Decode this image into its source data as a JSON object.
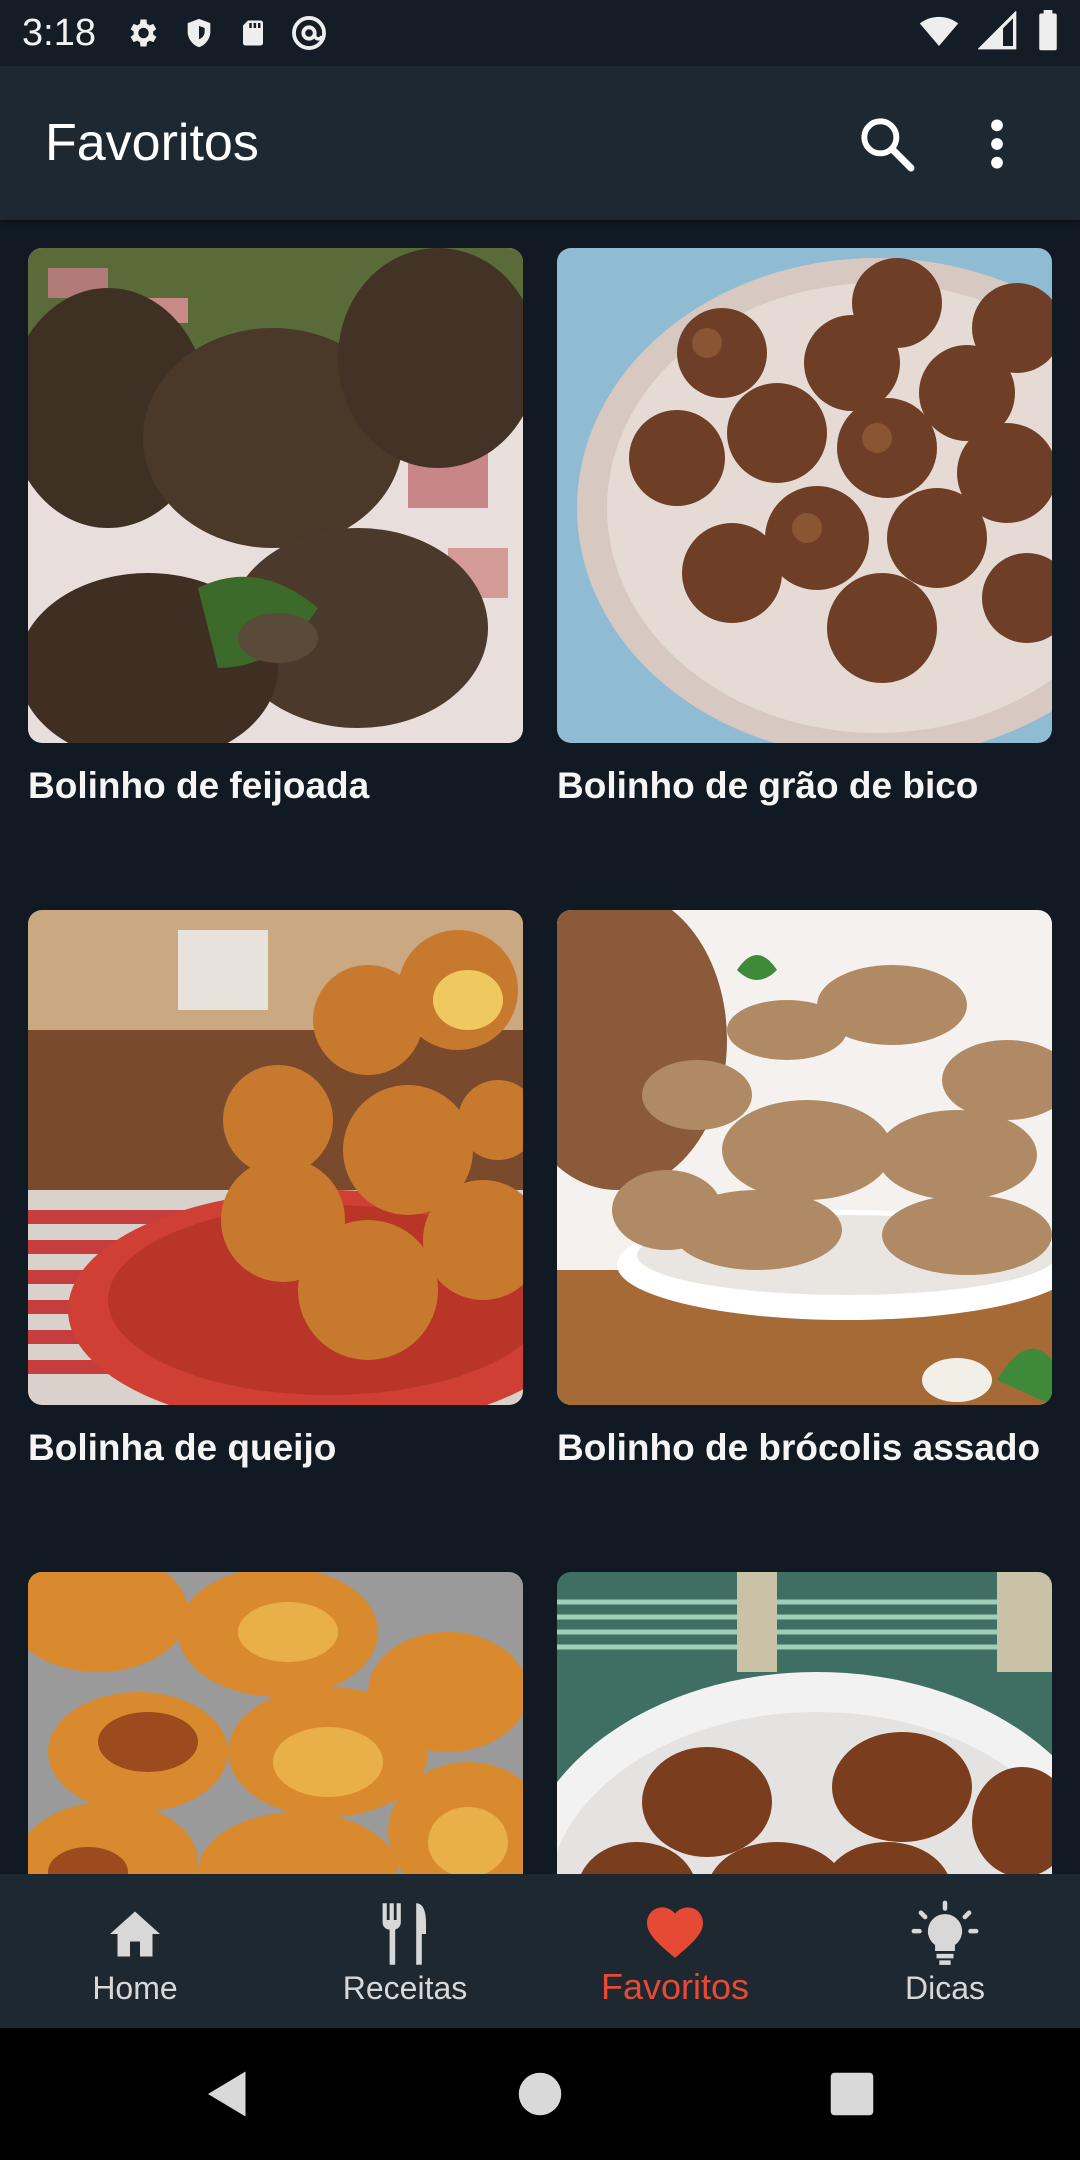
{
  "status_bar": {
    "time": "3:18",
    "left_icons": [
      "gear-icon",
      "shield-icon",
      "sd-card-icon",
      "at-sign-icon"
    ],
    "right_icons": [
      "wifi-icon",
      "signal-icon",
      "battery-icon"
    ]
  },
  "app_bar": {
    "title": "Favoritos",
    "actions": [
      "search-icon",
      "more-vert-icon"
    ]
  },
  "recipes": [
    {
      "name": "Bolinho de feijoada"
    },
    {
      "name": "Bolinho de grão de bico"
    },
    {
      "name": "Bolinha de queijo"
    },
    {
      "name": "Bolinho de brócolis assado"
    },
    {
      "name": ""
    },
    {
      "name": ""
    }
  ],
  "bottom_nav": {
    "items": [
      {
        "label": "Home",
        "icon": "home-icon",
        "active": false
      },
      {
        "label": "Receitas",
        "icon": "fork-knife-icon",
        "active": false
      },
      {
        "label": "Favoritos",
        "icon": "heart-icon",
        "active": true
      },
      {
        "label": "Dicas",
        "icon": "lightbulb-icon",
        "active": false
      }
    ],
    "active_color": "#e64a35"
  },
  "system_nav": [
    "back-icon",
    "home-circle-icon",
    "recents-icon"
  ]
}
